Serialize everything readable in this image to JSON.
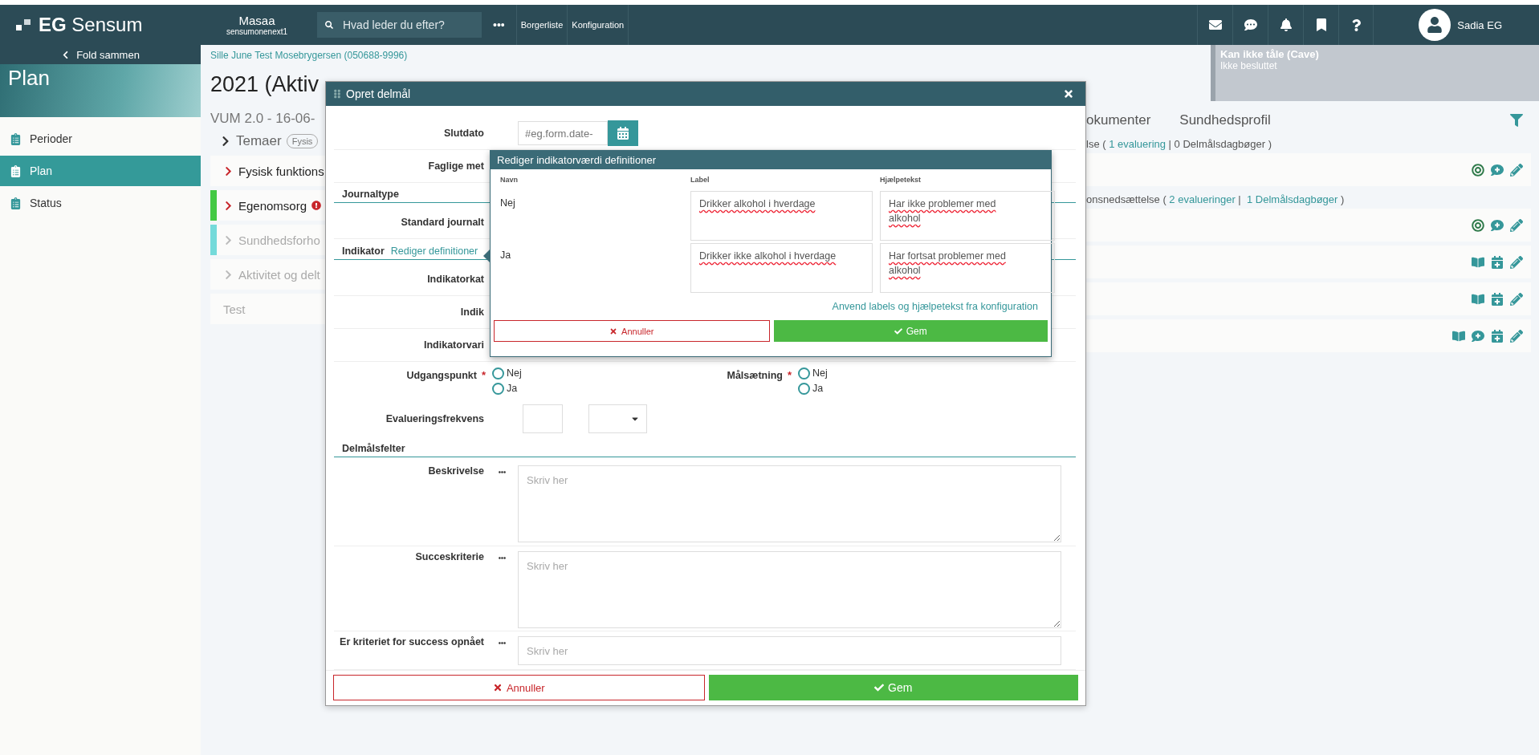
{
  "header": {
    "logo": "EG Sensum",
    "org": {
      "name": "Masaa",
      "sub": "sensumonenext1"
    },
    "search": {
      "placeholder": "Hvad leder du efter?"
    },
    "more": "•••",
    "nav": [
      "Borgerliste",
      "Konfiguration"
    ],
    "user": "Sadia EG"
  },
  "sidebar": {
    "collapse": "Fold sammen",
    "title": "Plan",
    "items": [
      {
        "label": "Perioder",
        "selected": false
      },
      {
        "label": "Plan",
        "selected": true
      },
      {
        "label": "Status",
        "selected": false
      }
    ]
  },
  "breadcrumb": "Sille June Test Mosebrygersen (050688-9996)",
  "alert": {
    "title": "Kan ikke tåle (Cave)",
    "status": "Ikke besluttet"
  },
  "plan": {
    "title": "2021 (Aktiv",
    "subtitle": "VUM 2.0 - 16-06-",
    "themes": {
      "label": "Temaer",
      "chip": "Fysis"
    },
    "rows": [
      {
        "kind": "theme",
        "label": "Fysisk funktions",
        "muted": false,
        "alert": false
      },
      {
        "kind": "theme",
        "label": "Egenomsorg",
        "muted": false,
        "alert": true,
        "color": "#44c944"
      },
      {
        "kind": "theme",
        "label": "Sundhedsforho",
        "muted": true,
        "alert": false,
        "color": "#74dada"
      },
      {
        "kind": "theme",
        "label": "Aktivitet og delt",
        "muted": true,
        "alert": false
      },
      {
        "kind": "note",
        "label": "Test",
        "muted": true,
        "alert": false
      }
    ]
  },
  "right": {
    "tabs": [
      "okumenter",
      "Sundhedsprofil"
    ],
    "groups": [
      {
        "caption": [
          {
            "text": "lse ( ",
            "link": false
          },
          {
            "text": "1 evaluering",
            "link": true
          },
          {
            "text": " | 0 Delmålsdagbøger )",
            "link": false
          }
        ],
        "cards": [
          {
            "kind": "goal"
          }
        ]
      },
      {
        "caption": [
          {
            "text": "onsnedsættelse ( ",
            "link": false
          },
          {
            "text": "2 evalueringer",
            "link": true
          },
          {
            "text": " |  ",
            "link": false
          },
          {
            "text": "1 Delmålsdagbøger",
            "link": true
          },
          {
            "text": " )",
            "link": false
          }
        ],
        "cards": [
          {
            "kind": "goal"
          },
          {
            "kind": "journal"
          },
          {
            "kind": "journal"
          },
          {
            "kind": "journal_full"
          }
        ]
      }
    ]
  },
  "modal": {
    "title": "Opret delmål",
    "fields": [
      {
        "kind": "date",
        "label": "Slutdato",
        "placeholder": "#eg.form.date-"
      },
      {
        "kind": "label",
        "label": "Faglige met"
      },
      {
        "kind": "section",
        "label": "Journaltype"
      },
      {
        "kind": "label",
        "label": "Standard journalt"
      },
      {
        "kind": "section",
        "label": "Indikator",
        "link": "Rediger definitioner"
      },
      {
        "kind": "label",
        "label": "Indikatorkat"
      },
      {
        "kind": "label",
        "label": "Indik"
      },
      {
        "kind": "input",
        "label": "Indikatorvari"
      },
      {
        "kind": "radios",
        "groups": [
          {
            "label": "Udgangspunkt",
            "mark": "*",
            "options": [
              {
                "label": "Nej",
                "selected": false
              },
              {
                "label": "Ja",
                "selected": false
              }
            ]
          },
          {
            "label": "Målsætning",
            "mark": "*",
            "options": [
              {
                "label": "Nej",
                "selected": false
              },
              {
                "label": "Ja",
                "selected": false
              }
            ]
          }
        ]
      },
      {
        "kind": "frequency",
        "label": "Evalueringsfrekvens"
      },
      {
        "kind": "section",
        "label": "Delmålsfelter"
      },
      {
        "kind": "textarea",
        "label": "Beskrivelse",
        "placeholder": "Skriv her"
      },
      {
        "kind": "textarea",
        "label": "Succeskriterie",
        "placeholder": "Skriv her"
      },
      {
        "kind": "textarea_short",
        "label": "Er kriteriet for success opnået",
        "placeholder": "Skriv her"
      }
    ],
    "cancel": "Annuller",
    "save": "Gem"
  },
  "popup": {
    "title": "Rediger indikatorværdi definitioner",
    "columns": [
      "Navn",
      "Label",
      "Hjælpetekst"
    ],
    "rows": [
      {
        "name": "Nej",
        "label": "Drikker alkohol i hverdage",
        "help": "Har ikke problemer med alkohol"
      },
      {
        "name": "Ja",
        "label": "Drikker ikke alkohol i hverdage",
        "help": "Har fortsat problemer med alkohol"
      }
    ],
    "link": "Anvend labels og hjælpetekst fra konfiguration",
    "cancel": "Annuller",
    "save": "Gem"
  }
}
